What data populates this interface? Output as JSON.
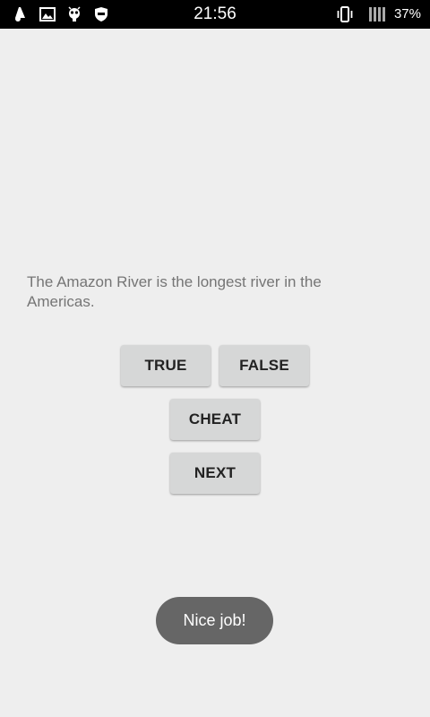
{
  "status_bar": {
    "time": "21:56",
    "battery": "37%",
    "icons": [
      "notification-icon",
      "image-icon",
      "android-debug-icon",
      "shield-icon",
      "vibrate-icon",
      "signal-icon"
    ]
  },
  "quiz": {
    "question": "The Amazon River is the longest river in the Americas.",
    "true_label": "TRUE",
    "false_label": "FALSE",
    "cheat_label": "CHEAT",
    "next_label": "NEXT"
  },
  "toast": {
    "message": "Nice job!"
  },
  "colors": {
    "background": "#eeeeee",
    "button": "#d6d7d7",
    "toast": "#666666",
    "question_text": "#757575"
  }
}
